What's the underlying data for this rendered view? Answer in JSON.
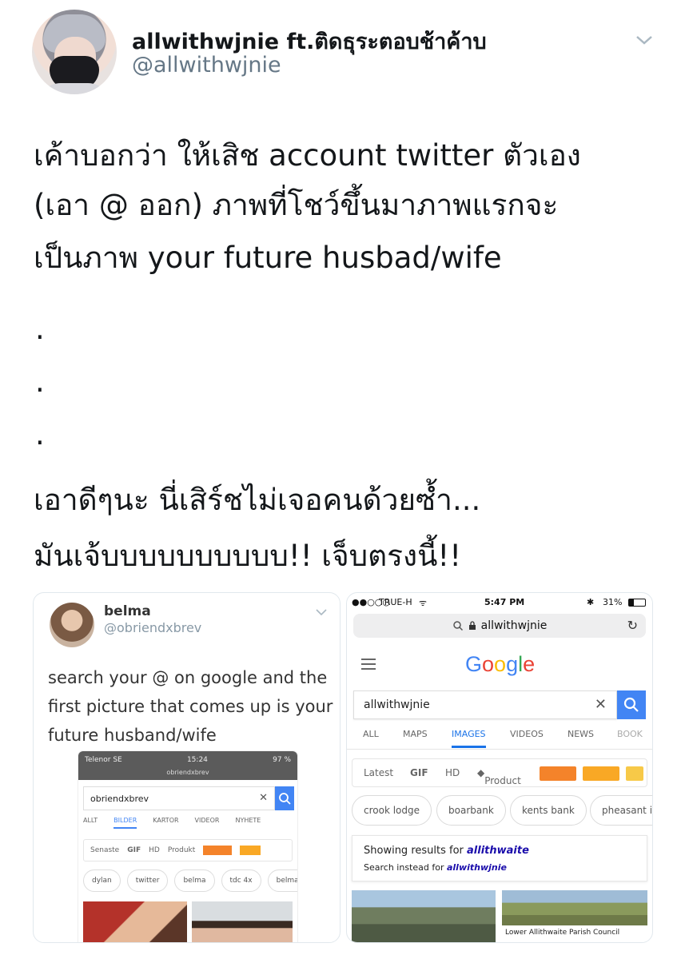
{
  "tweet": {
    "display_name": "allwithwjnie ft.ติดธุระตอบช้าค้าบ",
    "handle": "@allwithwjnie",
    "lines": [
      "เค้าบอกว่า ให้เสิช account twitter ตัวเอง",
      "(เอา @ ออก) ภาพที่โชว์ขึ้นมาภาพแรกจะ",
      "เป็นภาพ your future husbad/wife"
    ],
    "dots": [
      ".",
      ".",
      "."
    ],
    "lines2": [
      "เอาดีๆนะ นี่เสิร์ชไม่เจอคนด้วยซ้ำ...",
      "มันเจ้บบบบบบบบบบ!! เจ็บตรงนี้!!"
    ]
  },
  "embedded_left": {
    "name": "belma",
    "handle": "@obriendxbrev",
    "text": "search your @ on google and the first picture that comes up is your future husband/wife",
    "phone": {
      "carrier": "Telenor SE",
      "time": "15:24",
      "battery": "97 %",
      "url": "obriendxbrev",
      "query": "obriendxbrev",
      "tabs": [
        "ALLT",
        "BILDER",
        "KARTOR",
        "VIDEOR",
        "NYHETE"
      ],
      "active_tab": "BILDER",
      "filters": [
        "Senaste",
        "GIF",
        "HD",
        "Produkt"
      ],
      "chips": [
        "dylan",
        "twitter",
        "belma",
        "tdc 4x",
        "belma"
      ]
    }
  },
  "embedded_right": {
    "carrier": "TRUE-H",
    "time": "5:47 PM",
    "battery": "31%",
    "url": "allwithwjnie",
    "logo": "Google",
    "query": "allwithwjnie",
    "tabs": [
      "ALL",
      "MAPS",
      "IMAGES",
      "VIDEOS",
      "NEWS",
      "BOOK"
    ],
    "active_tab": "IMAGES",
    "filters": [
      "Latest",
      "GIF",
      "HD",
      "Product"
    ],
    "chips": [
      "crook lodge",
      "boarbank",
      "kents bank",
      "pheasant in"
    ],
    "showing_prefix": "Showing results for",
    "showing_term": "allithwaite",
    "instead_prefix": "Search instead for",
    "instead_term": "allwithwjnie",
    "image_caption": "Lower Allithwaite Parish Council",
    "colors": {
      "link": "#1a0dab",
      "accent": "#4285f4",
      "orange": "#f4832a",
      "amber": "#f9a825",
      "yellow": "#f7c948"
    }
  }
}
